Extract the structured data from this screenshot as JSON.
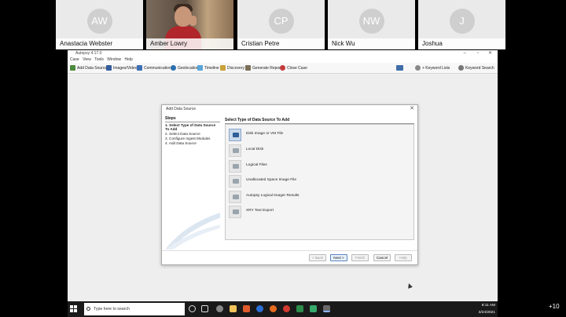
{
  "participants": [
    {
      "initials": "AW",
      "name": "Anastacia Webster"
    },
    {
      "initials": "",
      "name": "Amber Lowry"
    },
    {
      "initials": "CP",
      "name": "Cristian Petre"
    },
    {
      "initials": "NW",
      "name": "Nick Wu"
    },
    {
      "initials": "J",
      "name": "Joshua"
    }
  ],
  "app": {
    "title": "Autopsy 4.17.0",
    "menu": [
      "Case",
      "View",
      "Tools",
      "Window",
      "Help"
    ],
    "toolbar": {
      "add_data_source": "Add Data Source",
      "images_videos": "Images/Videos",
      "communications": "Communications",
      "geolocation": "Geolocation",
      "timeline": "Timeline",
      "discovery": "Discovery",
      "generate_report": "Generate Report",
      "close_case": "Close Case",
      "keyword_lists": "+ Keyword Lists",
      "keyword_search": "Keyword Search"
    }
  },
  "dialog": {
    "title": "Add Data Source",
    "steps_heading": "Steps",
    "steps": [
      {
        "num": "1.",
        "label": "Select Type of Data Source To Add"
      },
      {
        "num": "2.",
        "label": "Select Data Source"
      },
      {
        "num": "3.",
        "label": "Configure Ingest Modules"
      },
      {
        "num": "4.",
        "label": "Add Data Source"
      }
    ],
    "content_heading": "Select Type of Data Source To Add",
    "options": [
      "Disk Image or VM File",
      "Local Disk",
      "Logical Files",
      "Unallocated Space Image File",
      "Autopsy Logical Imager Results",
      "XRY Text Export"
    ],
    "buttons": {
      "back": "< Back",
      "next": "Next >",
      "finish": "Finish",
      "cancel": "Cancel",
      "help": "Help"
    }
  },
  "taskbar": {
    "search_placeholder": "Type here to search",
    "time": "8:11 AM",
    "date": "3/24/2021"
  },
  "overflow_count": "+10"
}
